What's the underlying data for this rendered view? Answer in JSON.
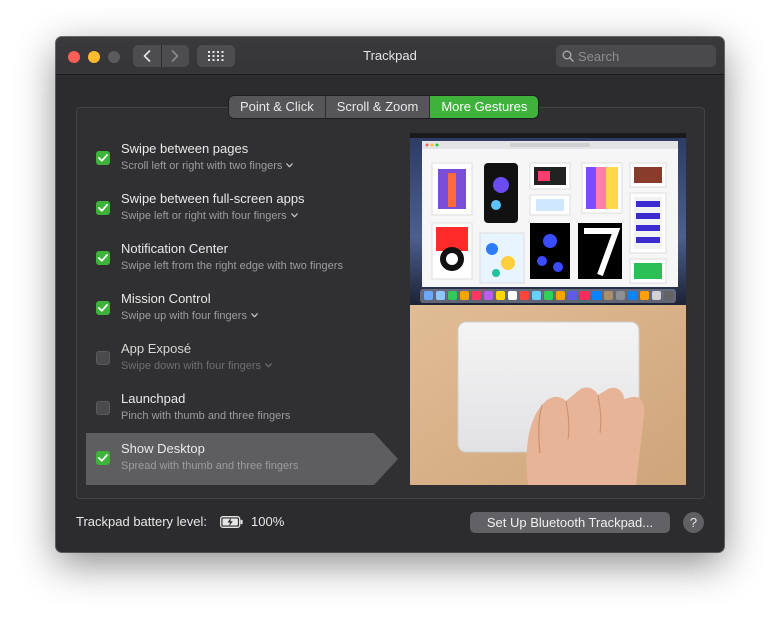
{
  "window": {
    "title": "Trackpad"
  },
  "search": {
    "placeholder": "Search"
  },
  "tabs": [
    {
      "label": "Point & Click",
      "active": false
    },
    {
      "label": "Scroll & Zoom",
      "active": false
    },
    {
      "label": "More Gestures",
      "active": true
    }
  ],
  "gestures": [
    {
      "title": "Swipe between pages",
      "subtitle": "Scroll left or right with two fingers",
      "checked": true,
      "has_menu": true
    },
    {
      "title": "Swipe between full-screen apps",
      "subtitle": "Swipe left or right with four fingers",
      "checked": true,
      "has_menu": true
    },
    {
      "title": "Notification Center",
      "subtitle": "Swipe left from the right edge with two fingers",
      "checked": true,
      "has_menu": false
    },
    {
      "title": "Mission Control",
      "subtitle": "Swipe up with four fingers",
      "checked": true,
      "has_menu": true
    },
    {
      "title": "App Exposé",
      "subtitle": "Swipe down with four fingers",
      "checked": false,
      "has_menu": true
    },
    {
      "title": "Launchpad",
      "subtitle": "Pinch with thumb and three fingers",
      "checked": false,
      "has_menu": false
    },
    {
      "title": "Show Desktop",
      "subtitle": "Spread with thumb and three fingers",
      "checked": true,
      "has_menu": false,
      "selected": true
    }
  ],
  "battery": {
    "label": "Trackpad battery level:",
    "value": "100%"
  },
  "buttons": {
    "setup_bluetooth": "Set Up Bluetooth Trackpad...",
    "help": "?"
  },
  "colors": {
    "accent": "#3fb23c",
    "window_bg": "#2c2c2e",
    "close": "#ff5f57",
    "minimize": "#febc2e"
  }
}
